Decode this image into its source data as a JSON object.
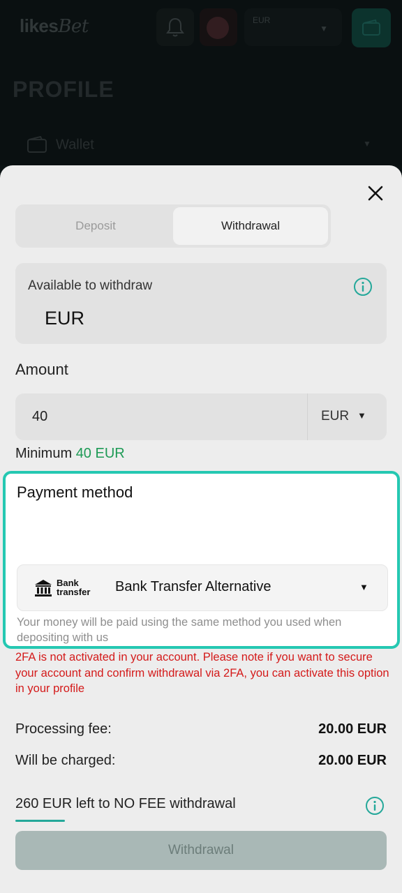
{
  "header": {
    "logo_text": "likes",
    "logo_script": "Bet",
    "currency_label": "EUR"
  },
  "profile": {
    "title": "PROFILE",
    "wallet_label": "Wallet"
  },
  "modal": {
    "tabs": [
      {
        "label": "Deposit",
        "active": false
      },
      {
        "label": "Withdrawal",
        "active": true
      }
    ],
    "available": {
      "label": "Available to withdraw",
      "currency": "EUR"
    },
    "amount": {
      "title": "Amount",
      "value": "40",
      "currency": "EUR"
    },
    "minimum": {
      "label": "Minimum",
      "value": "40 EUR"
    },
    "payment": {
      "title": "Payment method",
      "logo_line1": "Bank",
      "logo_line2": "transfer",
      "selected": "Bank Transfer Alternative",
      "note": "Your money will be paid using the same method you used when depositing with us"
    },
    "warning": "2FA is not activated in your account. Please note if you want to secure your account and confirm withdrawal via 2FA, you can activate this option in your profile",
    "fees": [
      {
        "label": "Processing fee:",
        "value": "20.00 EUR"
      },
      {
        "label": "Will be charged:",
        "value": "20.00 EUR"
      }
    ],
    "nofee": {
      "text": "260 EUR left to NO FEE withdrawal",
      "progress_fraction": 0.13
    },
    "submit_label": "Withdrawal"
  },
  "colors": {
    "accent": "#25c8b2",
    "success": "#1d9a55",
    "danger": "#d41a1a"
  }
}
